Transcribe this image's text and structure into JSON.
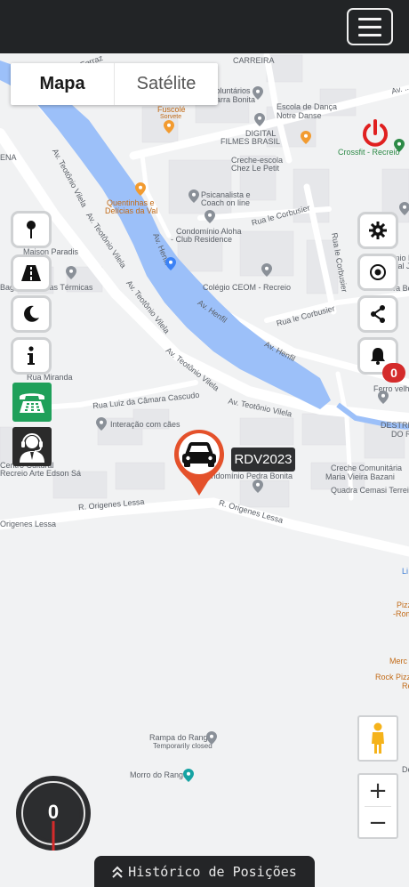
{
  "topbar": {
    "menu_icon": "hamburger-icon"
  },
  "map_type": {
    "options": [
      "Mapa",
      "Satélite"
    ],
    "selected": "Mapa"
  },
  "map_labels": {
    "ferraz": "Ferraz",
    "carreira": "CARREIRA",
    "voluntarios": "Voluntários",
    "barra_bonita": "Barra Bonita",
    "escola_danca": "Escola de Dança",
    "notre_danse": "Notre Danse",
    "av_top": "Av. ...",
    "fuscole": "Fuscolé",
    "sorvete": "Sorvete",
    "digital": "DIGITAL",
    "filmes": "FILMES BRASIL",
    "crossfit": "Crossfit - Recreio",
    "creche_escola": "Creche-escola",
    "chez": "Chez Le Petit",
    "ena": "ENA",
    "quentinhas1": "Quentinhas e",
    "quentinhas2": "Delícias da Val",
    "psicanalista1": "Psicanalista e",
    "psicanalista2": "Coach on line",
    "cond_aloha1": "Condomínio Aloha",
    "cond_aloha2": "- Club Residence",
    "rua_corbusier1": "Rua le Corbusier",
    "rua_corbusier2": "Rua le Corbusier",
    "rua_corbusier3": "Rua le Corbusier",
    "av_henfil1": "Av. Henfil",
    "av_henfil2": "Av. Henfil",
    "av_henfil3": "Av. Henfil",
    "colegio": "Colégio CEOM - Recreio",
    "cond_e1": "Condomínio E",
    "cond_e2": "Residencial Jarc",
    "wav_barra": "Wav Barra Bo",
    "maison1": "Maison Paradis",
    "bagatol": "Bagatol Sacolas Térmicas",
    "rua_miranda": "Rua Miranda",
    "av_teotonio1": "Av. Teotônio Vilela",
    "av_teotonio2": "Av. Teotônio Vilela",
    "av_teotonio3": "Av. Teotônio Vilela",
    "av_teotonio4": "Av. Teotônio Vilela",
    "av_teotonio5": "Av. Teotônio Vilela",
    "rua_camara": "Rua Luiz da Câmara Cascudo",
    "interacao": "Interação com cães",
    "ferro_velho": "Ferro velho",
    "destribuidora": "DESTRIB",
    "dora": "DO R",
    "centro_cultural1": "Centro Cultural",
    "centro_cultural2": "Recreio Arte Edson Sá",
    "cond_pedra": "Condomínio Pedra Bonita",
    "creche_comunitaria1": "Creche Comunitária",
    "creche_comunitaria2": "Maria Vieira Bazani",
    "quadra": "Quadra Cemasi Terreirão",
    "r_origenes1": "R. Origenes Lessa",
    "r_origenes2": "R. Origenes Lessa",
    "origenes_left": "Origenes Lessa",
    "li": "Li",
    "pizz1": "Pizz",
    "pizz2": "-Rom",
    "merc": "Merc",
    "rock_pizza": "Rock Pizza",
    "rock_pizza2": "Re",
    "rampa1": "Rampa do Rangel",
    "rampa2": "Temporarily closed",
    "morro": "Morro do Rangel",
    "de": "De"
  },
  "left_toolbar": [
    {
      "icon": "map-pin-icon"
    },
    {
      "icon": "road-icon"
    },
    {
      "icon": "moon-icon"
    },
    {
      "icon": "info-icon"
    },
    {
      "icon": "telephone-icon",
      "color": "#1fa05a"
    },
    {
      "icon": "support-agent-icon",
      "color": "#2b2b2b"
    }
  ],
  "right_toolbar": [
    {
      "icon": "gear-icon"
    },
    {
      "icon": "target-icon"
    },
    {
      "icon": "share-icon"
    },
    {
      "icon": "bell-icon"
    }
  ],
  "notifications": {
    "count": "0"
  },
  "power": {
    "icon": "power-icon",
    "color": "#e02020"
  },
  "vehicle": {
    "plate": "RDV2023",
    "icon": "car-icon",
    "marker_color": "#e4512b"
  },
  "speedometer": {
    "speed": "0"
  },
  "history": {
    "label": "Histórico de Posições",
    "icon": "double-chevron-up-icon"
  },
  "zoom": {
    "in_label": "+",
    "out_label": "−"
  },
  "pegman": {
    "icon": "street-view-icon"
  },
  "colors": {
    "water": "#9cc0f9",
    "road": "#ffffff",
    "block": "#e8e9eb",
    "topbar": "#222426"
  }
}
